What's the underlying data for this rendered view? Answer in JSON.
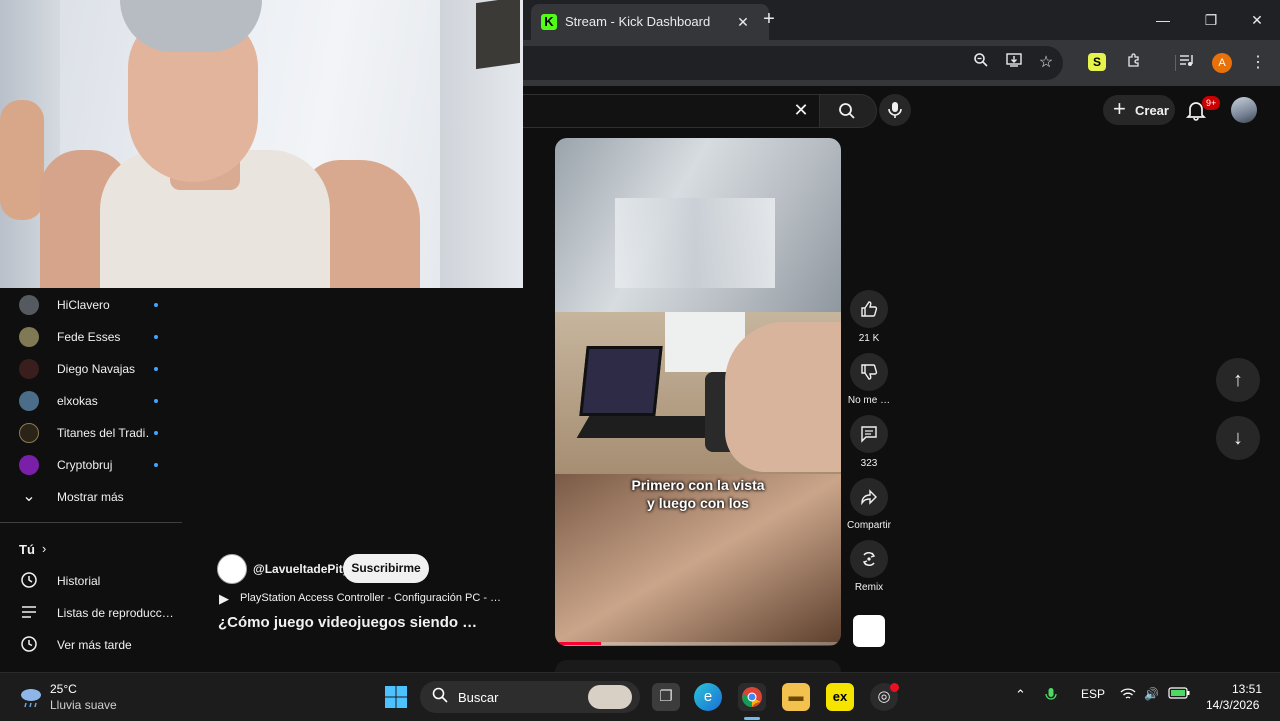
{
  "browser": {
    "tab_title": "Stream - Kick Dashboard",
    "tab_favicon_letter": "K",
    "profile_initial": "A",
    "extension_letter": "S"
  },
  "youtube": {
    "create_label": "Crear",
    "notification_badge": "9+"
  },
  "sidebar": {
    "subscriptions": [
      {
        "name": "HiClavero",
        "color": "#555a60"
      },
      {
        "name": "Fede Esses",
        "color": "#7f7a55"
      },
      {
        "name": "Diego Navajas",
        "color": "#3a1e1e"
      },
      {
        "name": "elxokas",
        "color": "#4b6d8a"
      },
      {
        "name": "Titanes del Tradi…",
        "color": "#2a2418"
      },
      {
        "name": "Cryptobruj",
        "color": "#7a1fa8"
      }
    ],
    "show_more": "Mostrar más",
    "you_section": "Tú",
    "you_items": [
      {
        "label": "Historial",
        "icon": "history-icon"
      },
      {
        "label": "Listas de reproducc…",
        "icon": "playlist-icon"
      },
      {
        "label": "Ver más tarde",
        "icon": "clock-icon"
      }
    ]
  },
  "short": {
    "channel": "@LavueltadePity",
    "subscribe_label": "Suscribirme",
    "linked_video": "PlayStation Access Controller - Configuración PC - …",
    "title": "¿Cómo juego videojuegos siendo …",
    "caption_line1": "Primero con la vista",
    "caption_line2": "y luego con los",
    "progress": 0.16,
    "actions": {
      "likes": "21 K",
      "dislike_label": "No me …",
      "comments": "323",
      "share_label": "Compartir",
      "remix_label": "Remix"
    }
  },
  "taskbar": {
    "temperature": "25°C",
    "weather": "Lluvia suave",
    "search_placeholder": "Buscar",
    "language": "ESP",
    "time": "13:51",
    "date": "14/3/2026"
  }
}
